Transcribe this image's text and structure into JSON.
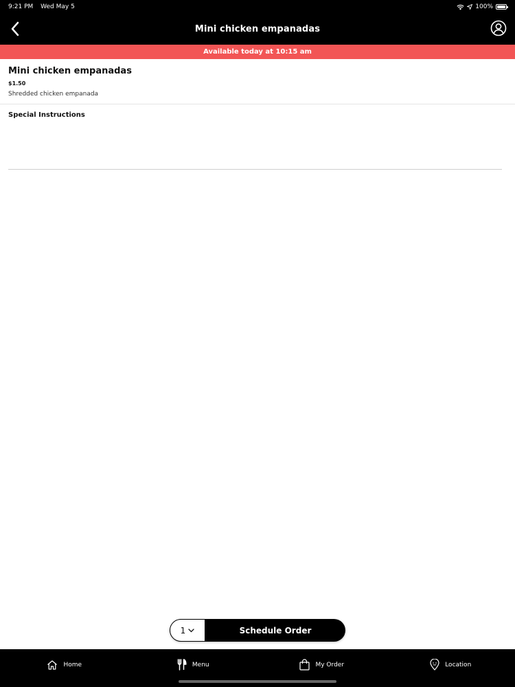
{
  "status_bar": {
    "time": "9:21 PM",
    "date": "Wed May 5",
    "battery": "100%",
    "icons": [
      "wifi-icon",
      "location-arrow-icon",
      "battery-icon"
    ]
  },
  "nav": {
    "title": "Mini chicken empanadas",
    "back_icon": "chevron-left-icon",
    "profile_icon": "user-circle-icon"
  },
  "banner": {
    "text": "Available today at 10:15 am",
    "color": "#f25555"
  },
  "item": {
    "name": "Mini chicken empanadas",
    "price": "$1.50",
    "description": "Shredded chicken empanada"
  },
  "special_instructions": {
    "label": "Special Instructions",
    "value": "",
    "placeholder": ""
  },
  "order": {
    "quantity": "1",
    "quantity_icon": "chevron-down-icon",
    "schedule_label": "Schedule Order"
  },
  "tabs": [
    {
      "label": "Home",
      "icon": "home-icon"
    },
    {
      "label": "Menu",
      "icon": "fork-knife-icon"
    },
    {
      "label": "My Order",
      "icon": "shopping-bag-icon"
    },
    {
      "label": "Location",
      "icon": "map-pin-icon"
    }
  ],
  "colors": {
    "header": "#000000",
    "accent": "#f25555",
    "background": "#ffffff"
  }
}
